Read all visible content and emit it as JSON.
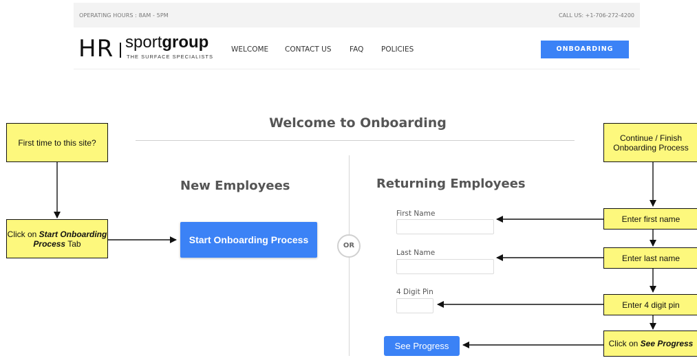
{
  "topbar": {
    "hours": "OPERATING HOURS : 8AM - 5PM",
    "call": "CALL US: +1-706-272-4200"
  },
  "logo": {
    "hr": "HR",
    "brand_light": "sport",
    "brand_bold": "group",
    "tagline": "THE SURFACE SPECIALISTS"
  },
  "nav": {
    "items": [
      "WELCOME",
      "CONTACT US",
      "FAQ",
      "POLICIES"
    ],
    "cta": "ONBOARDING"
  },
  "main": {
    "title": "Welcome to Onboarding",
    "or": "OR",
    "new": {
      "title": "New Employees",
      "button": "Start Onboarding Process"
    },
    "returning": {
      "title": "Returning Employees",
      "first_label": "First Name",
      "first_value": "",
      "last_label": "Last Name",
      "last_value": "",
      "pin_label": "4 Digit Pin",
      "pin_value": "",
      "button": "See Progress"
    }
  },
  "callouts": {
    "first_time": "First time to this site?",
    "click_start_pre": "Click on ",
    "click_start_em": "Start Onboarding Process",
    "click_start_post": " Tab",
    "continue": "Continue / Finish Onboarding Process",
    "enter_first": "Enter first name",
    "enter_last": "Enter last name",
    "enter_pin": "Enter 4 digit pin",
    "click_see_pre": "Click on ",
    "click_see_em": "See Progress"
  },
  "colors": {
    "accent_blue": "#3b82f6",
    "callout_yellow": "#fdf87d"
  }
}
